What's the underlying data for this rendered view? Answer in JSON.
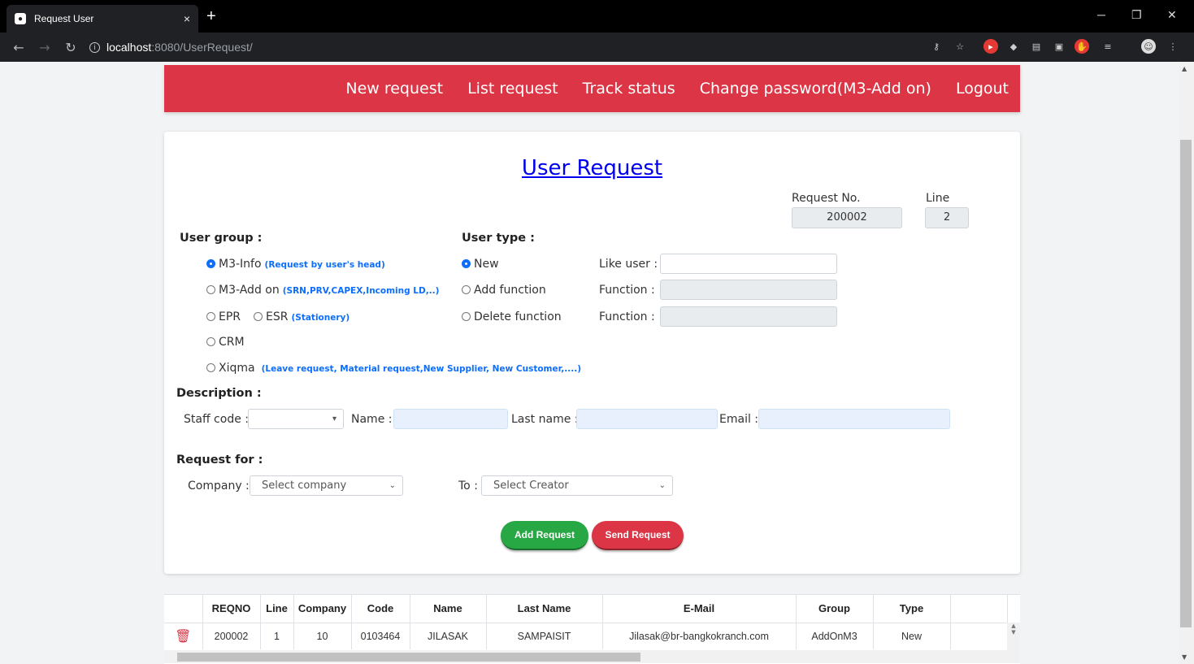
{
  "browser": {
    "tab_title": "Request User",
    "tab_close": "×",
    "new_tab": "+",
    "url_host": "localhost",
    "url_path": ":8080/UserRequest/"
  },
  "nav": {
    "items": [
      "New request",
      "List request",
      "Track status",
      "Change password(M3-Add on)",
      "Logout"
    ]
  },
  "form": {
    "title": "User Request",
    "request_no_label": "Request No.",
    "request_no": "200002",
    "line_label": "Line",
    "line": "2",
    "user_group_label": "User group :",
    "user_groups": {
      "m3_info": "M3-Info",
      "m3_info_note": "(Request by user's head)",
      "m3_addon": "M3-Add on",
      "m3_addon_note": "(SRN,PRV,CAPEX,Incoming LD,..)",
      "epr": "EPR",
      "esr": "ESR",
      "esr_note": "(Stationery)",
      "crm": "CRM",
      "xiqma": "Xiqma",
      "xiqma_note": "(Leave request, Material request,New Supplier, New Customer,....)"
    },
    "user_type_label": "User type :",
    "user_types": {
      "new": "New",
      "add_function": "Add function",
      "delete_function": "Delete function"
    },
    "like_user_label": "Like user :",
    "function_label_1": "Function :",
    "function_label_2": "Function :",
    "description_label": "Description :",
    "staff_code_label": "Staff code :",
    "name_label": "Name :",
    "last_name_label": "Last name :",
    "email_label": "Email :",
    "request_for_label": "Request for :",
    "company_label": "Company :",
    "company_select": "Select company",
    "to_label": "To :",
    "creator_select": "Select Creator",
    "add_button": "Add Request",
    "send_button": "Send Request"
  },
  "table": {
    "headers": [
      "REQNO",
      "Line",
      "Company",
      "Code",
      "Name",
      "Last Name",
      "E-Mail",
      "Group",
      "Type"
    ],
    "rows": [
      {
        "reqno": "200002",
        "line": "1",
        "company": "10",
        "code": "0103464",
        "name": "JILASAK",
        "last_name": "SAMPAISIT",
        "email": "Jilasak@br-bangkokranch.com",
        "group": "AddOnM3",
        "type": "New"
      }
    ]
  },
  "colors": {
    "nav_bg": "#dc3545",
    "add_button": "#28a745",
    "send_button": "#dc3545",
    "title_link": "#0000ee"
  }
}
